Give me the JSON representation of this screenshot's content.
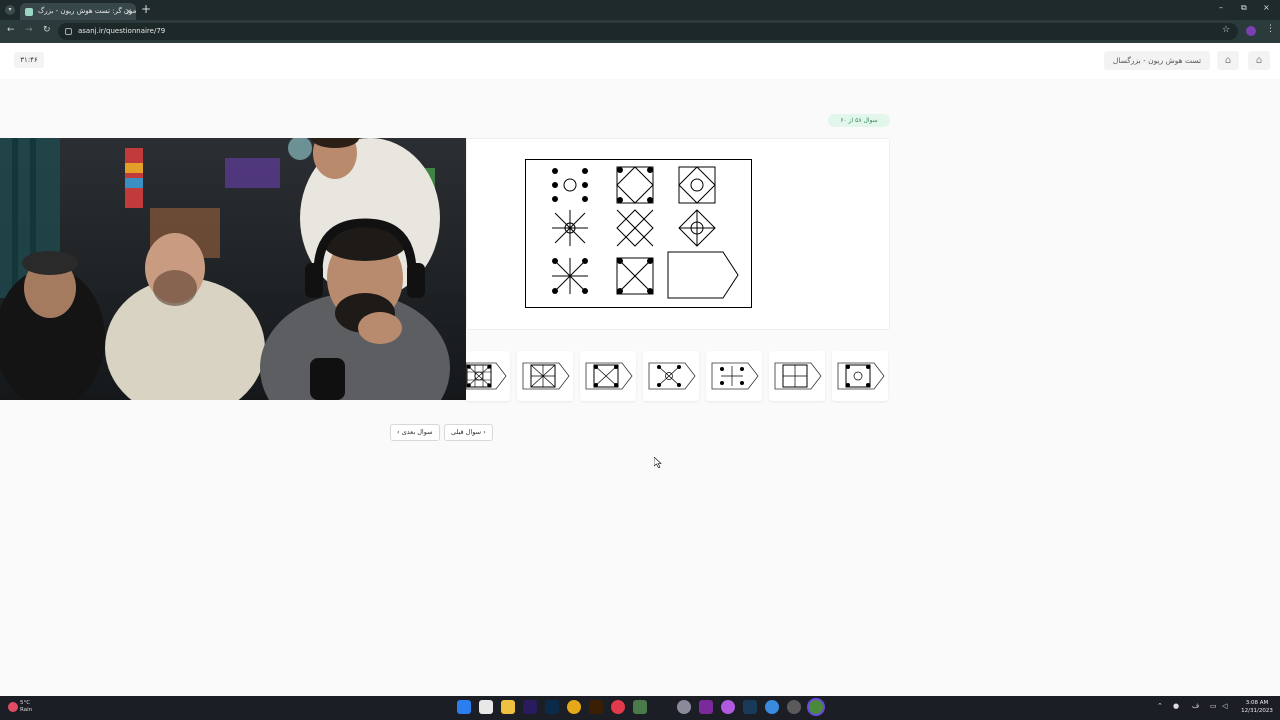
{
  "browser": {
    "tab_title": "آزمون گر: تست هوش ریون - بزرگ…",
    "tab_close": "×",
    "new_tab": "+",
    "url": "asanj.ir/questionnaire/79",
    "window_controls": {
      "minimize": "–",
      "restore": "⧉",
      "close": "×"
    }
  },
  "site": {
    "timer": "۳۱:۴۶",
    "test_title": "تست هوش ریون - بزرگسال",
    "question_counter": "سوال ۵۸ از ۶۰"
  },
  "navigation": {
    "next_label": "سوال بعدی",
    "prev_label": "سوال قبلی"
  },
  "options": [
    {
      "icon": "dense-grid-with-circle-and-dots-icon"
    },
    {
      "icon": "square-grid-with-diagonals-icon"
    },
    {
      "icon": "square-with-diagonals-and-corner-dots-icon"
    },
    {
      "icon": "x-with-circle-and-corner-dots-icon"
    },
    {
      "icon": "plus-with-corner-dots-icon"
    },
    {
      "icon": "square-with-plus-icon"
    },
    {
      "icon": "square-with-circle-and-corner-dots-icon"
    }
  ],
  "taskbar": {
    "weather_temp": "5°C",
    "weather_desc": "Rain",
    "time": "3:08 AM",
    "date": "12/31/2023"
  },
  "colors": {
    "browser_dark": "#1e2a2b",
    "counter_bg": "#e3f6ec",
    "counter_text": "#3a8b5f"
  }
}
